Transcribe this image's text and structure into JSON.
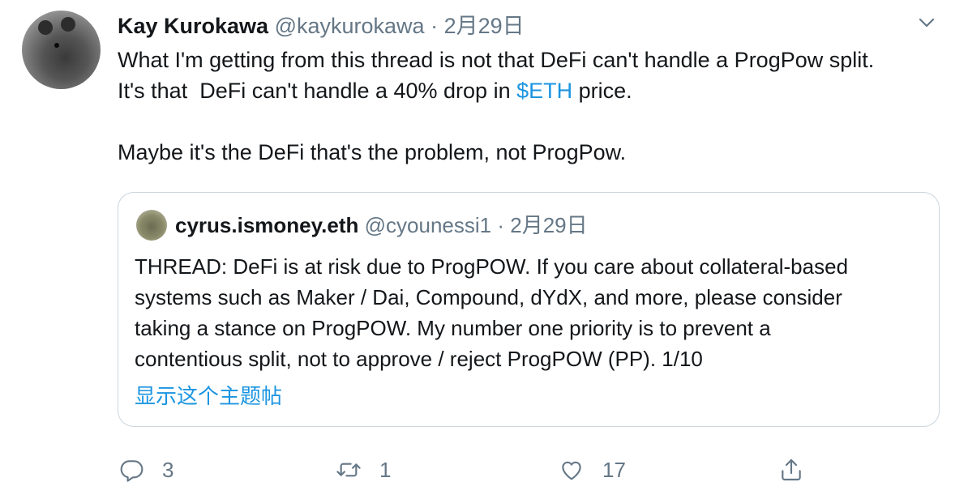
{
  "tweet": {
    "author_name": "Kay Kurokawa",
    "author_handle": "@kaykurokawa",
    "separator": "·",
    "date": "2月29日",
    "text_line1": "What I'm getting from this thread is not that DeFi can't handle a ProgPow split.",
    "text_line2_before": "It's that  DeFi can't handle a 40% drop in ",
    "text_line2_link": "$ETH",
    "text_line2_after": " price.",
    "text_line3": "Maybe it's the DeFi that's the problem, not ProgPow."
  },
  "quoted": {
    "author_name": "cyrus.ismoney.eth",
    "author_handle": "@cyounessi1",
    "separator": "·",
    "date": "2月29日",
    "lines": [
      "THREAD: DeFi is at risk due to ProgPOW. If you care about collateral-based",
      "systems such as Maker / Dai, Compound, dYdX, and more, please consider",
      "taking a stance on ProgPOW. My number one priority is to prevent a",
      "contentious split, not to approve / reject ProgPOW (PP). 1/10"
    ],
    "show_thread": "显示这个主题帖"
  },
  "actions": {
    "reply_count": "3",
    "retweet_count": "1",
    "like_count": "17"
  },
  "icons": {
    "reply": "reply-icon",
    "retweet": "retweet-icon",
    "like": "heart-icon",
    "share": "share-icon",
    "caret": "chevron-down-icon"
  },
  "colors": {
    "link": "#1b95e0",
    "secondary": "#657786",
    "border": "#ccd6dd"
  }
}
